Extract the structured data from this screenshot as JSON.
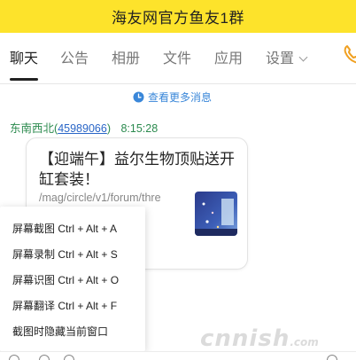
{
  "window": {
    "title": "海友网官方鱼友1群"
  },
  "tabs": [
    {
      "label": "聊天"
    },
    {
      "label": "公告"
    },
    {
      "label": "相册"
    },
    {
      "label": "文件"
    },
    {
      "label": "应用"
    },
    {
      "label": "设置"
    }
  ],
  "chat": {
    "view_more": "查看更多消息",
    "sender_name": "东南西北",
    "sender_qq": "45989066",
    "open_paren": "(",
    "close_paren": ")",
    "timestamp": "8:15:28"
  },
  "card": {
    "title": "【迎端午】益尔生物顶贴送开缸套装！",
    "url": "/mag/circle/v1/forum/thre"
  },
  "context_menu": {
    "items": [
      {
        "label": "屏幕截图 Ctrl + Alt + A"
      },
      {
        "label": "屏幕录制 Ctrl + Alt + S"
      },
      {
        "label": "屏幕识图 Ctrl + Alt + O"
      },
      {
        "label": "屏幕翻译 Ctrl + Alt + F"
      },
      {
        "label": "截图时隐藏当前窗口"
      }
    ]
  },
  "watermark": {
    "text": "cnnish",
    "suffix": ".com"
  },
  "colors": {
    "title_bar": "#fde32b",
    "link_blue": "#3a87d9",
    "sender_green": "#2b8a4e",
    "phone_orange": "#f0a020"
  },
  "icons": {
    "view_more": "clock-icon",
    "call": "phone-icon",
    "settings_dropdown": "chevron-down-icon"
  }
}
